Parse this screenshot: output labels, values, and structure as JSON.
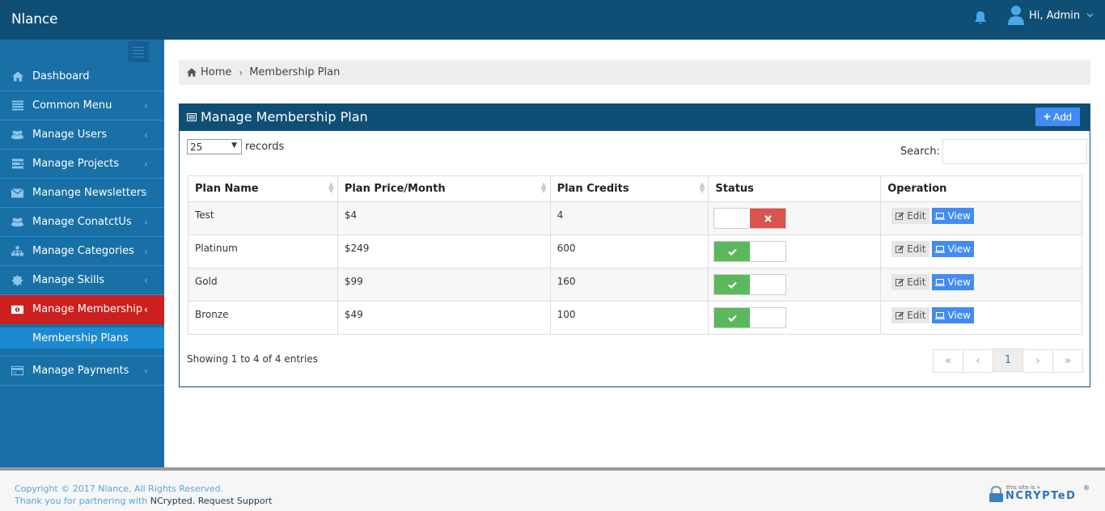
{
  "header": {
    "brand": "Nlance",
    "user_greeting": "Hi, Admin"
  },
  "sidebar": {
    "items": [
      {
        "label": "Dashboard",
        "icon": "home-icon",
        "has_chevron": false
      },
      {
        "label": "Common Menu",
        "icon": "list-icon",
        "has_chevron": true
      },
      {
        "label": "Manage Users",
        "icon": "users-icon",
        "has_chevron": true
      },
      {
        "label": "Manage Projects",
        "icon": "tasks-icon",
        "has_chevron": true
      },
      {
        "label": "Manange Newsletters",
        "icon": "envelope-icon",
        "has_chevron": true
      },
      {
        "label": "Manage ConatctUs",
        "icon": "users-icon",
        "has_chevron": true
      },
      {
        "label": "Manage Categories",
        "icon": "sitemap-icon",
        "has_chevron": true
      },
      {
        "label": "Manage Skills",
        "icon": "certificate-icon",
        "has_chevron": true
      },
      {
        "label": "Manage Membership",
        "icon": "money-icon",
        "has_chevron": true,
        "active": true
      },
      {
        "label": "Manage Payments",
        "icon": "credit-card-icon",
        "has_chevron": true
      }
    ],
    "subitems": [
      {
        "label": "Membership Plans",
        "active": true
      }
    ],
    "chevron": "‹"
  },
  "breadcrumb": {
    "home": "Home",
    "separator": "›",
    "current": "Membership Plan"
  },
  "panel": {
    "title": "Manage Membership Plan",
    "add_label": "Add",
    "length_value": "25",
    "length_suffix": "records",
    "search_label": "Search:",
    "search_value": "",
    "columns": [
      "Plan Name",
      "Plan Price/Month",
      "Plan Credits",
      "Status",
      "Operation"
    ],
    "rows": [
      {
        "name": "Test",
        "price": "$4",
        "credits": "4",
        "status": "inactive"
      },
      {
        "name": "Platinum",
        "price": "$249",
        "credits": "600",
        "status": "active"
      },
      {
        "name": "Gold",
        "price": "$99",
        "credits": "160",
        "status": "active"
      },
      {
        "name": "Bronze",
        "price": "$49",
        "credits": "100",
        "status": "active"
      }
    ],
    "edit_label": "Edit",
    "view_label": "View",
    "info": "Showing 1 to 4 of 4 entries",
    "pager": {
      "first": "«",
      "prev": "‹",
      "current": "1",
      "next": "›",
      "last": "»"
    }
  },
  "footer": {
    "copyright": "Copyright © 2017 Nlance, All Rights Reserved.",
    "partner_prefix": "Thank you for partnering with ",
    "partner_name": "NCrypted.",
    "support": " Request Support",
    "badge_small": "this site is »",
    "badge_big": "NCRYPTeD",
    "badge_reg": "®"
  },
  "colors": {
    "header_bg": "#0f4f75",
    "sidebar_bg": "#1870a6",
    "active_item": "#cc1f1f",
    "accent_blue": "#428bf5",
    "status_on": "#5cb85c",
    "status_off": "#d9534f"
  }
}
